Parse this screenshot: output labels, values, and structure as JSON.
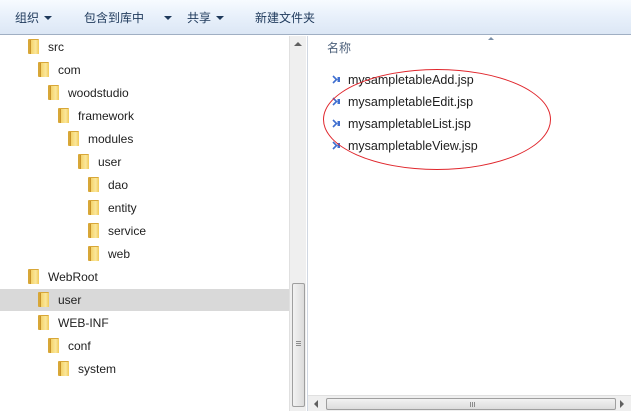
{
  "toolbar": {
    "organize_label": "组织",
    "include_library_label": "包含到库中",
    "share_label": "共享",
    "new_folder_label": "新建文件夹"
  },
  "tree": {
    "items": [
      {
        "label": "src"
      },
      {
        "label": "com"
      },
      {
        "label": "woodstudio"
      },
      {
        "label": "framework"
      },
      {
        "label": "modules"
      },
      {
        "label": "user"
      },
      {
        "label": "dao"
      },
      {
        "label": "entity"
      },
      {
        "label": "service"
      },
      {
        "label": "web"
      },
      {
        "label": "WebRoot"
      },
      {
        "label": "user"
      },
      {
        "label": "WEB-INF"
      },
      {
        "label": "conf"
      },
      {
        "label": "system"
      }
    ],
    "selected_index": 11
  },
  "files": {
    "column_header": "名称",
    "items": [
      {
        "name": "mysampletableAdd.jsp"
      },
      {
        "name": "mysampletableEdit.jsp"
      },
      {
        "name": "mysampletableList.jsp"
      },
      {
        "name": "mysampletableView.jsp"
      }
    ]
  },
  "icons": {
    "folder": "folder-icon",
    "file": "jsp-file-icon",
    "dropdown": "chevron-down-icon"
  },
  "colors": {
    "highlight_ring": "#e0262c",
    "selected_row": "#d9d9d9",
    "file_icon": "#3f6fd0"
  }
}
